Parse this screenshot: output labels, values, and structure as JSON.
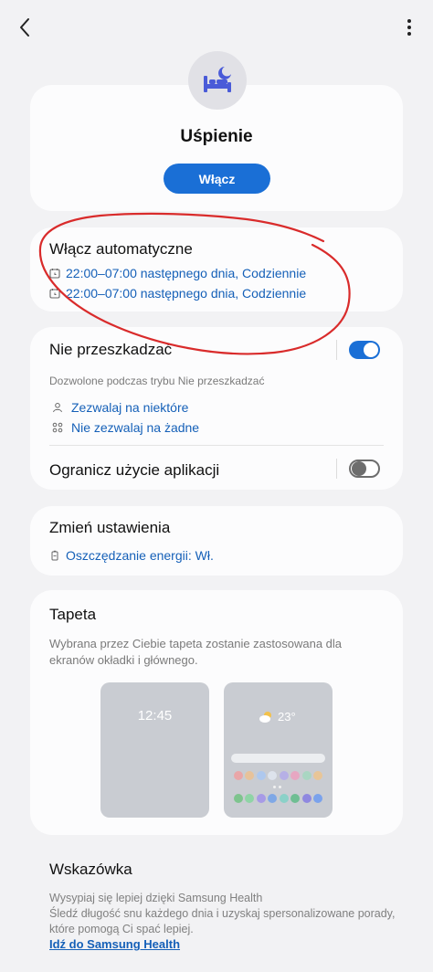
{
  "header": {
    "back_icon": "back-arrow-icon",
    "more_icon": "more-vertical-icon"
  },
  "mode": {
    "icon": "bed-moon-icon",
    "title": "Uśpienie",
    "turn_on_label": "Włącz"
  },
  "auto": {
    "title": "Włącz automatyczne",
    "schedules": [
      "22:00–07:00 następnego dnia, Codziennie",
      "22:00–07:00 następnego dnia, Codziennie"
    ]
  },
  "dnd": {
    "title": "Nie przeszkadzać",
    "enabled": true,
    "subtitle": "Dozwolone podczas trybu Nie przeszkadzać",
    "allow_some": "Zezwalaj na niektóre",
    "allow_none": "Nie zezwalaj na żadne",
    "limit_apps": "Ogranicz użycie aplikacji",
    "limit_apps_enabled": false
  },
  "change": {
    "title": "Zmień ustawienia",
    "power_saving": "Oszczędzanie energii: Wł."
  },
  "wallpaper": {
    "title": "Tapeta",
    "description": "Wybrana przez Ciebie tapeta zostanie zastosowana dla ekranów okładki i głównego.",
    "cover_clock": "12:45",
    "home_temp": "23°",
    "dot_colors_row1": [
      "#e9a6a8",
      "#e7c29a",
      "#aec8ee",
      "#dde3ec",
      "#b6b0e6",
      "#e7a7c2",
      "#a9d6c2",
      "#e8c597"
    ],
    "dot_colors_row2": [
      "#7ec48e",
      "#8fd4a6",
      "#a79ae6",
      "#7fa8e6",
      "#8bd1c8",
      "#6fbe93",
      "#8f88e0",
      "#7aa2ec"
    ]
  },
  "tip": {
    "title": "Wskazówka",
    "line1": "Wysypiaj się lepiej dzięki Samsung Health",
    "line2": "Śledź długość snu każdego dnia i uzyskaj spersonalizowane porady, które pomogą Ci spać lepiej.",
    "link": "Idź do Samsung Health"
  },
  "colors": {
    "accent": "#1a6fd6",
    "link": "#1560b8",
    "annotation": "#d92b2b"
  }
}
